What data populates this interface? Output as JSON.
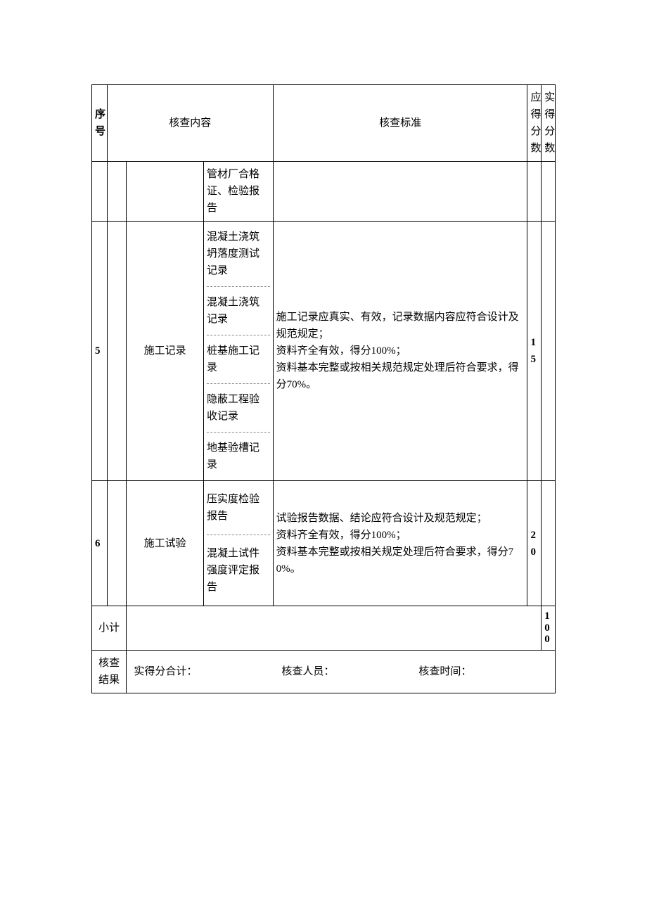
{
  "header": {
    "seq": "序号",
    "content": "核查内容",
    "standard": "核查标准",
    "should": "应得分数",
    "actual": "实得分数"
  },
  "rows": {
    "r0": {
      "sub": "管材厂合格证、检验报告"
    },
    "r5": {
      "seq": "5",
      "cat": "施工记录",
      "subs": {
        "a": "混凝土浇筑坍落度测试记录",
        "b": "混凝土浇筑记录",
        "c": "桩基施工记录",
        "d": "隐蔽工程验收记录",
        "e": "地基验槽记录"
      },
      "std": "施工记录应真实、有效，记录数据内容应符合设计及规范规定；\n资料齐全有效，得分100%；\n资料基本完整或按相关规范规定处理后符合要求，得分70%。",
      "score": "15"
    },
    "r6": {
      "seq": "6",
      "cat": "施工试验",
      "subs": {
        "a": "压实度检验报告",
        "b": "混凝土试件强度评定报告"
      },
      "std": "试验报告数据、结论应符合设计及规范规定；\n资料齐全有效，得分100%；\n资料基本完整或按相关规定处理后符合要求，得分70%。",
      "score": "20"
    }
  },
  "subtotal": {
    "label": "小计",
    "value": "100"
  },
  "result": {
    "label": "核查结果",
    "actual_total": "实得分合计：",
    "reviewer": "核查人员：",
    "time": "核查时间："
  }
}
